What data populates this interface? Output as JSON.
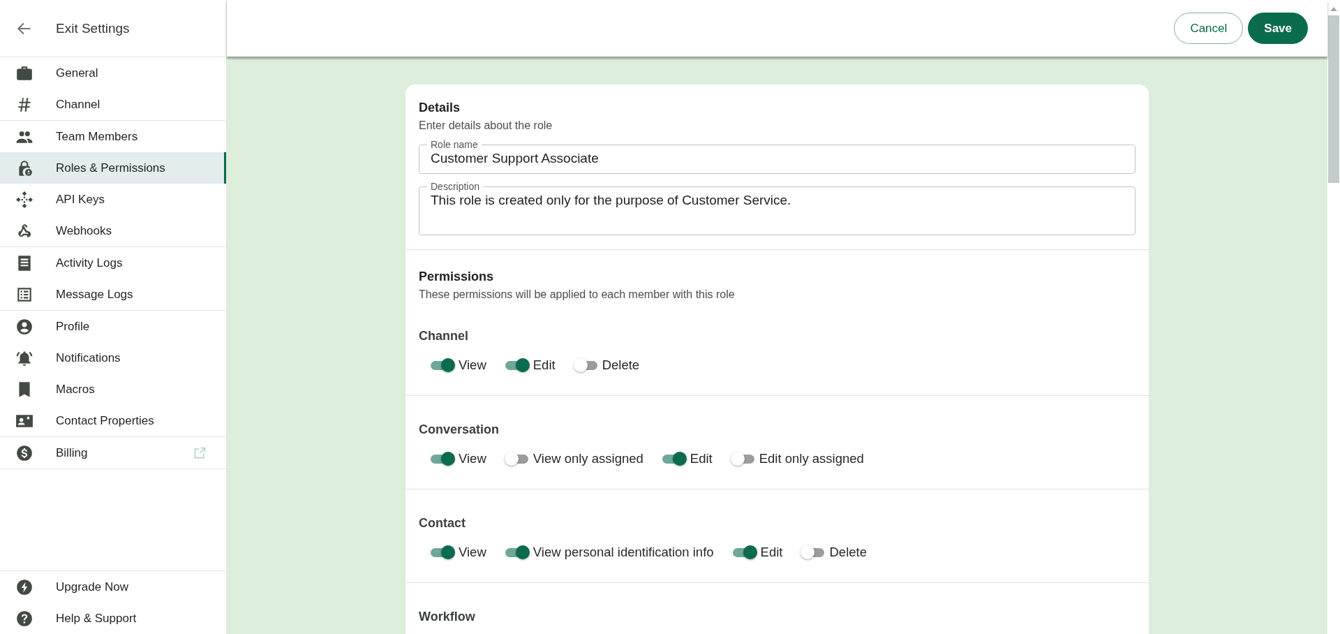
{
  "sidebar": {
    "exit": {
      "label": "Exit Settings"
    },
    "groups": [
      [
        {
          "label": "General",
          "selected": false
        },
        {
          "label": "Channel",
          "selected": false
        }
      ],
      [
        {
          "label": "Team Members",
          "selected": false
        },
        {
          "label": "Roles & Permissions",
          "selected": true
        },
        {
          "label": "API Keys",
          "selected": false
        },
        {
          "label": "Webhooks",
          "selected": false
        }
      ],
      [
        {
          "label": "Activity Logs",
          "selected": false
        },
        {
          "label": "Message Logs",
          "selected": false
        }
      ],
      [
        {
          "label": "Profile",
          "selected": false
        },
        {
          "label": "Notifications",
          "selected": false
        },
        {
          "label": "Macros",
          "selected": false
        },
        {
          "label": "Contact Properties",
          "selected": false
        }
      ],
      [
        {
          "label": "Billing",
          "selected": false,
          "external": true
        }
      ]
    ],
    "bottom": [
      {
        "label": "Upgrade Now"
      },
      {
        "label": "Help & Support"
      }
    ]
  },
  "header": {
    "buttons": [
      {
        "label": "Cancel",
        "kind": "secondary"
      },
      {
        "label": "Save",
        "kind": "primary"
      }
    ]
  },
  "details": {
    "title": "Details",
    "subtitle": "Enter details about the role",
    "fields": [
      {
        "label": "Role name",
        "value": "Customer Support Associate",
        "kind": "input"
      },
      {
        "label": "Description",
        "value": "This role is created only for the purpose of Customer Service.",
        "kind": "textarea"
      }
    ]
  },
  "permissions": {
    "title": "Permissions",
    "subtitle": "These permissions will be applied to each member with this role",
    "groups": [
      {
        "title": "Channel",
        "toggles": [
          {
            "label": "View",
            "on": true
          },
          {
            "label": "Edit",
            "on": true
          },
          {
            "label": "Delete",
            "on": false
          }
        ]
      },
      {
        "title": "Conversation",
        "toggles": [
          {
            "label": "View",
            "on": true
          },
          {
            "label": "View only assigned",
            "on": false
          },
          {
            "label": "Edit",
            "on": true
          },
          {
            "label": "Edit only assigned",
            "on": false
          }
        ]
      },
      {
        "title": "Contact",
        "toggles": [
          {
            "label": "View",
            "on": true
          },
          {
            "label": "View personal identification info",
            "on": true
          },
          {
            "label": "Edit",
            "on": true
          },
          {
            "label": "Delete",
            "on": false
          }
        ]
      },
      {
        "title": "Workflow"
      }
    ]
  }
}
